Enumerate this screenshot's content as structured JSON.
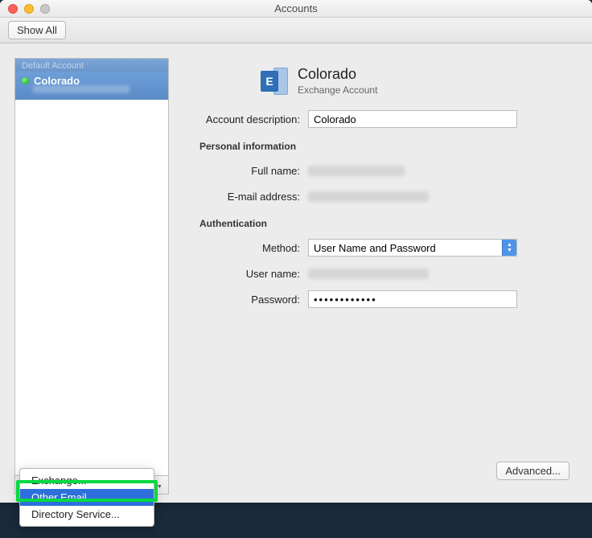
{
  "window": {
    "title": "Accounts"
  },
  "toolbar": {
    "show_all": "Show All"
  },
  "sidebar": {
    "section_header": "Default Account",
    "items": [
      {
        "name": "Colorado"
      }
    ]
  },
  "account": {
    "title": "Colorado",
    "subtitle": "Exchange Account"
  },
  "form": {
    "desc_label": "Account description:",
    "desc_value": "Colorado",
    "section_personal": "Personal information",
    "fullname_label": "Full name:",
    "email_label": "E-mail address:",
    "section_auth": "Authentication",
    "method_label": "Method:",
    "method_value": "User Name and Password",
    "username_label": "User name:",
    "password_label": "Password:",
    "password_value": "••••••••••••"
  },
  "advanced_label": "Advanced...",
  "popup": {
    "items": [
      "Exchange...",
      "Other Email...",
      "Directory Service..."
    ],
    "selected_index": 1
  }
}
